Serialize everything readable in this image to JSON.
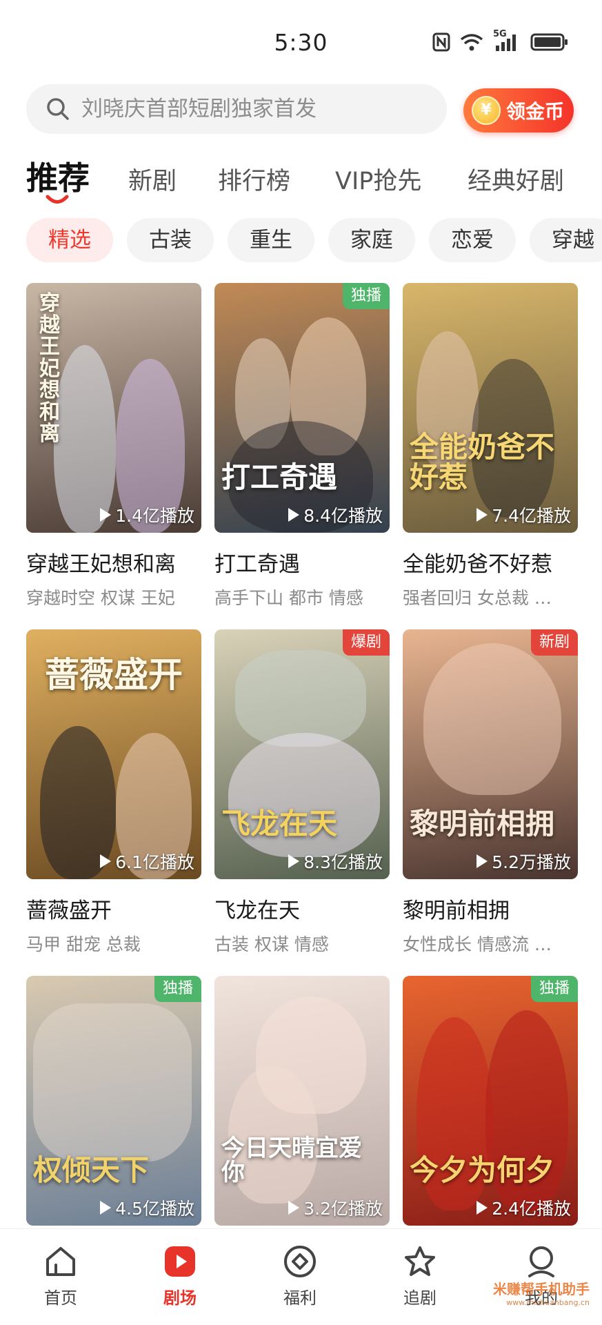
{
  "status_bar": {
    "time": "5:30",
    "network": "5G"
  },
  "search": {
    "placeholder": "刘晓庆首部短剧独家首发"
  },
  "coin_button": {
    "symbol": "¥",
    "label": "领金币"
  },
  "top_tabs": [
    {
      "label": "推荐",
      "active": true
    },
    {
      "label": "新剧",
      "active": false
    },
    {
      "label": "排行榜",
      "active": false
    },
    {
      "label": "VIP抢先",
      "active": false
    },
    {
      "label": "经典好剧",
      "active": false
    }
  ],
  "chips": [
    {
      "label": "精选",
      "active": true
    },
    {
      "label": "古装",
      "active": false
    },
    {
      "label": "重生",
      "active": false
    },
    {
      "label": "家庭",
      "active": false
    },
    {
      "label": "恋爱",
      "active": false
    },
    {
      "label": "穿越",
      "active": false
    }
  ],
  "dramas": [
    {
      "title": "穿越王妃想和离",
      "tags": "穿越时空 权谋 王妃",
      "plays": "1.4亿播放",
      "badge": "",
      "poster_text": "穿越王妃想和离",
      "colors": [
        "#4a3b34",
        "#c9b7a6"
      ]
    },
    {
      "title": "打工奇遇",
      "tags": "高手下山 都市 情感",
      "plays": "8.4亿播放",
      "badge": "独播",
      "poster_text": "打工奇遇",
      "colors": [
        "#33414f",
        "#c28a55"
      ]
    },
    {
      "title": "全能奶爸不好惹",
      "tags": "强者回归 女总裁 …",
      "plays": "7.4亿播放",
      "badge": "",
      "poster_text": "全能奶爸不好惹",
      "colors": [
        "#6a5b3d",
        "#d8b66a"
      ]
    },
    {
      "title": "蔷薇盛开",
      "tags": "马甲 甜宠 总裁",
      "plays": "6.1亿播放",
      "badge": "",
      "poster_text": "蔷薇盛开",
      "colors": [
        "#6b4a22",
        "#e0b060"
      ]
    },
    {
      "title": "飞龙在天",
      "tags": "古装 权谋 情感",
      "plays": "8.3亿播放",
      "badge": "爆剧",
      "poster_text": "飞龙在天",
      "colors": [
        "#55604f",
        "#d9d2b8"
      ]
    },
    {
      "title": "黎明前相拥",
      "tags": "女性成长 情感流 …",
      "plays": "5.2万播放",
      "badge": "新剧",
      "poster_text": "黎明前相拥",
      "colors": [
        "#4a3530",
        "#e9b590"
      ]
    },
    {
      "title": "",
      "tags": "",
      "plays": "4.5亿播放",
      "badge": "独播",
      "poster_text": "权倾天下",
      "colors": [
        "#6c7f96",
        "#d9c9b0"
      ]
    },
    {
      "title": "",
      "tags": "",
      "plays": "3.2亿播放",
      "badge": "",
      "poster_text": "今日天晴宜爱你",
      "colors": [
        "#b9a9a5",
        "#f1e4dc"
      ]
    },
    {
      "title": "",
      "tags": "",
      "plays": "2.4亿播放",
      "badge": "独播",
      "poster_text": "今夕为何夕",
      "colors": [
        "#8a1d18",
        "#e8652f"
      ]
    }
  ],
  "bottom_nav": [
    {
      "label": "首页",
      "icon": "home-icon",
      "active": false
    },
    {
      "label": "剧场",
      "icon": "play-icon",
      "active": true
    },
    {
      "label": "福利",
      "icon": "diamond-icon",
      "active": false
    },
    {
      "label": "追剧",
      "icon": "star-icon",
      "active": false
    },
    {
      "label": "我的",
      "icon": "profile-icon",
      "active": false
    }
  ],
  "watermark": {
    "text": "米赚帮手机助手",
    "url": "www.mizhuanbang.cn"
  },
  "colors": {
    "accent": "#e8332a",
    "badge_green": "#4fb56a",
    "badge_red": "#e4453b"
  }
}
